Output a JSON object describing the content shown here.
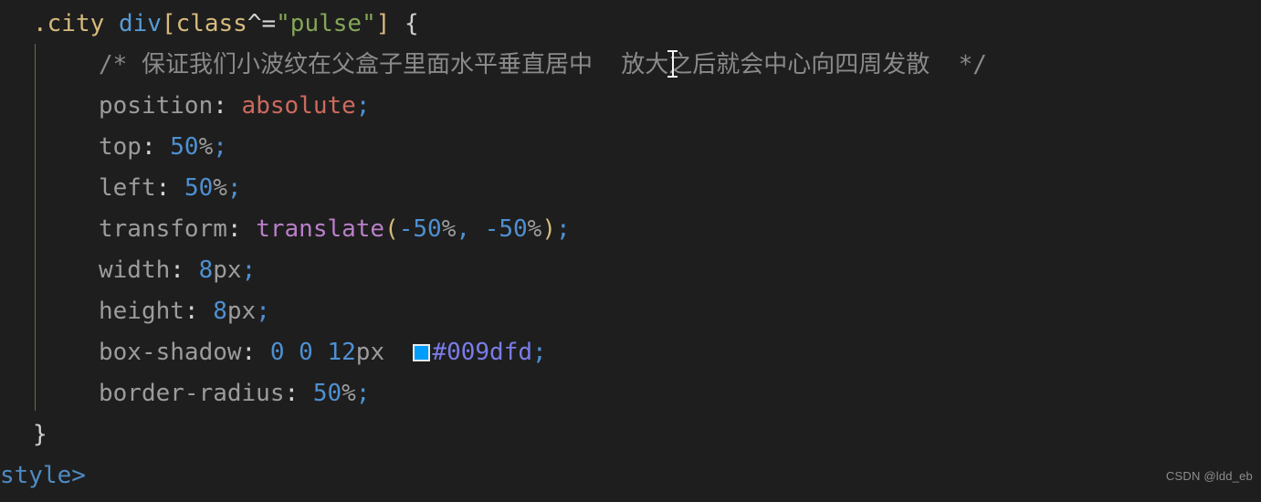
{
  "editor": {
    "background_color": "#1e1e1e",
    "language": "css",
    "line_height_px": 45,
    "font_size_px": 26
  },
  "code": {
    "line1": {
      "selector_class": ".city",
      "tag": "div",
      "bracket_open": "[",
      "attribute": "class",
      "operator": "^=",
      "string": "\"pulse\"",
      "bracket_close": "]",
      "brace_open": "{"
    },
    "line2": {
      "comment": "/* 保证我们小波纹在父盒子里面水平垂直居中  放大之后就会中心向四周发散  */"
    },
    "line3": {
      "property": "position",
      "colon": ":",
      "value": "absolute",
      "semicolon": ";"
    },
    "line4": {
      "property": "top",
      "colon": ":",
      "number": "50",
      "unit": "%",
      "semicolon": ";"
    },
    "line5": {
      "property": "left",
      "colon": ":",
      "number": "50",
      "unit": "%",
      "semicolon": ";"
    },
    "line6": {
      "property": "transform",
      "colon": ":",
      "function": "translate",
      "paren_open": "(",
      "arg1_number": "-50",
      "arg1_unit": "%",
      "comma": ",",
      "arg2_number": "-50",
      "arg2_unit": "%",
      "paren_close": ")",
      "semicolon": ";"
    },
    "line7": {
      "property": "width",
      "colon": ":",
      "number": "8",
      "unit": "px",
      "semicolon": ";"
    },
    "line8": {
      "property": "height",
      "colon": ":",
      "number": "8",
      "unit": "px",
      "semicolon": ";"
    },
    "line9": {
      "property": "box-shadow",
      "colon": ":",
      "offset_x": "0",
      "offset_y": "0",
      "blur_number": "12",
      "blur_unit": "px",
      "color_hex": "#009dfd",
      "swatch_color": "#009dfd",
      "semicolon": ";"
    },
    "line10": {
      "property": "border-radius",
      "colon": ":",
      "number": "50",
      "unit": "%",
      "semicolon": ";"
    },
    "line11": {
      "brace_close": "}"
    },
    "line12": {
      "closing_tag": "style>"
    }
  },
  "watermark": {
    "text": "CSDN @ldd_eb"
  },
  "colors": {
    "selector": "#d7ba7d",
    "tag": "#569cd6",
    "string": "#85a657",
    "comment": "#8a8a8a",
    "property": "#9c9c9c",
    "keyword": "#ce6a5d",
    "number": "#4e90d2",
    "function": "#b97fc9",
    "hex_value": "#7a7ce8",
    "indent_guide": "#7a7556"
  }
}
